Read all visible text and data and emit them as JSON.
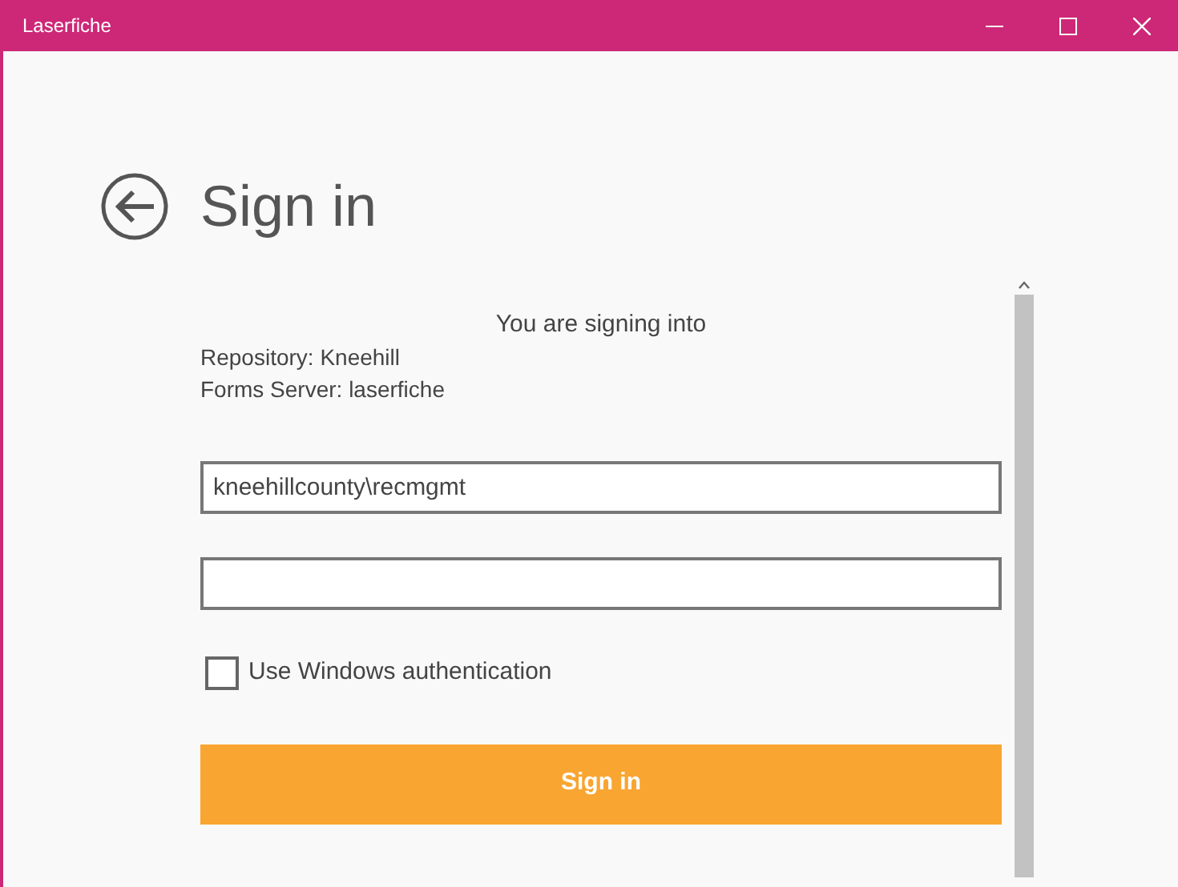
{
  "window": {
    "title": "Laserfiche"
  },
  "heading": "Sign in",
  "intro": "You are signing into",
  "details": [
    "Repository: Kneehill",
    "Forms Server: laserfiche"
  ],
  "username": {
    "value": "kneehillcounty\\recmgmt"
  },
  "windows_auth": {
    "label": "Use Windows authentication",
    "checked": false
  },
  "submit": {
    "label": "Sign in"
  }
}
